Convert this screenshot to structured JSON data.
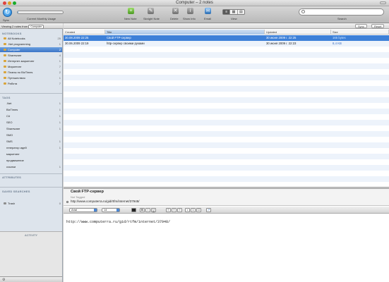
{
  "window": {
    "title": "Computer – 2 notes"
  },
  "toolbar": {
    "sync_label": "Sync",
    "usage_label": "Current Monthly Usage",
    "usage_fraction": 0.02,
    "new_note_label": "New Note",
    "inkey_note_label": "Sknight Note",
    "delete_label": "Delete",
    "show_info_label": "Show Info",
    "email_label": "Email",
    "view_label": "View",
    "search_label": "Search",
    "search_placeholder": ""
  },
  "sidebar": {
    "viewing_text": "Viewing 2 notes from",
    "viewing_select": "Computer",
    "notebooks_head": "NOTEBOOKS",
    "notebooks": [
      {
        "label": "All Notebooks",
        "count": "25"
      },
      {
        "label": ".Net programming",
        "count": "1"
      },
      {
        "label": "Computer",
        "count": "2"
      },
      {
        "label": "Shareware",
        "count": "4"
      },
      {
        "label": "Интернет-маркетинг",
        "count": "1"
      },
      {
        "label": "Маркетинг",
        "count": "7"
      },
      {
        "label": "Планы по BizTimes",
        "count": "2"
      },
      {
        "label": "Путешествия",
        "count": "1"
      },
      {
        "label": "Работа",
        "count": "7"
      }
    ],
    "tags_head": "TAGS",
    "tags": [
      {
        "label": ".Net",
        "count": "1"
      },
      {
        "label": "BizTimes",
        "count": "1"
      },
      {
        "label": "C#",
        "count": "1"
      },
      {
        "label": "SEO",
        "count": "1"
      },
      {
        "label": "Shareware",
        "count": "1"
      },
      {
        "label": "SMO",
        "count": ""
      },
      {
        "label": "SMS",
        "count": "1"
      },
      {
        "label": "генератор идей",
        "count": "1"
      },
      {
        "label": "маркетинг",
        "count": ""
      },
      {
        "label": "продвижение",
        "count": ""
      },
      {
        "label": "ссылки",
        "count": "1"
      }
    ],
    "attributes_head": "ATTRIBUTES",
    "saved_searches_head": "SAVED SEARCHES",
    "trash_label": "Trash",
    "trash_count": "0",
    "activity_head": "ACTIVITY"
  },
  "list": {
    "sync_btn": "Sync",
    "reset_btn": "Reset",
    "columns": [
      "Created",
      "Title",
      "Updated",
      "Size"
    ],
    "rows": [
      {
        "created": "30.08.2009 22:25",
        "title": "Свой FTP-сервер",
        "updated": "30 июня 2009 г. 22:25",
        "size": "165 bytes",
        "selected": true
      },
      {
        "created": "30.06.2009 22:19",
        "title": "http-сервер своими руками",
        "updated": "30 июня 2009 г. 22:23",
        "size": "8,4 KB",
        "selected": false
      }
    ]
  },
  "editor": {
    "title": "Свой FTP-сервер",
    "tags": "Not Tagged",
    "url": "http://www.computerra.ru/gid/rtfm/internet/37948/",
    "font": "Arial",
    "size": "14",
    "body": "http://www.computerra.ru/gid/rtfm/internet/37948/"
  }
}
